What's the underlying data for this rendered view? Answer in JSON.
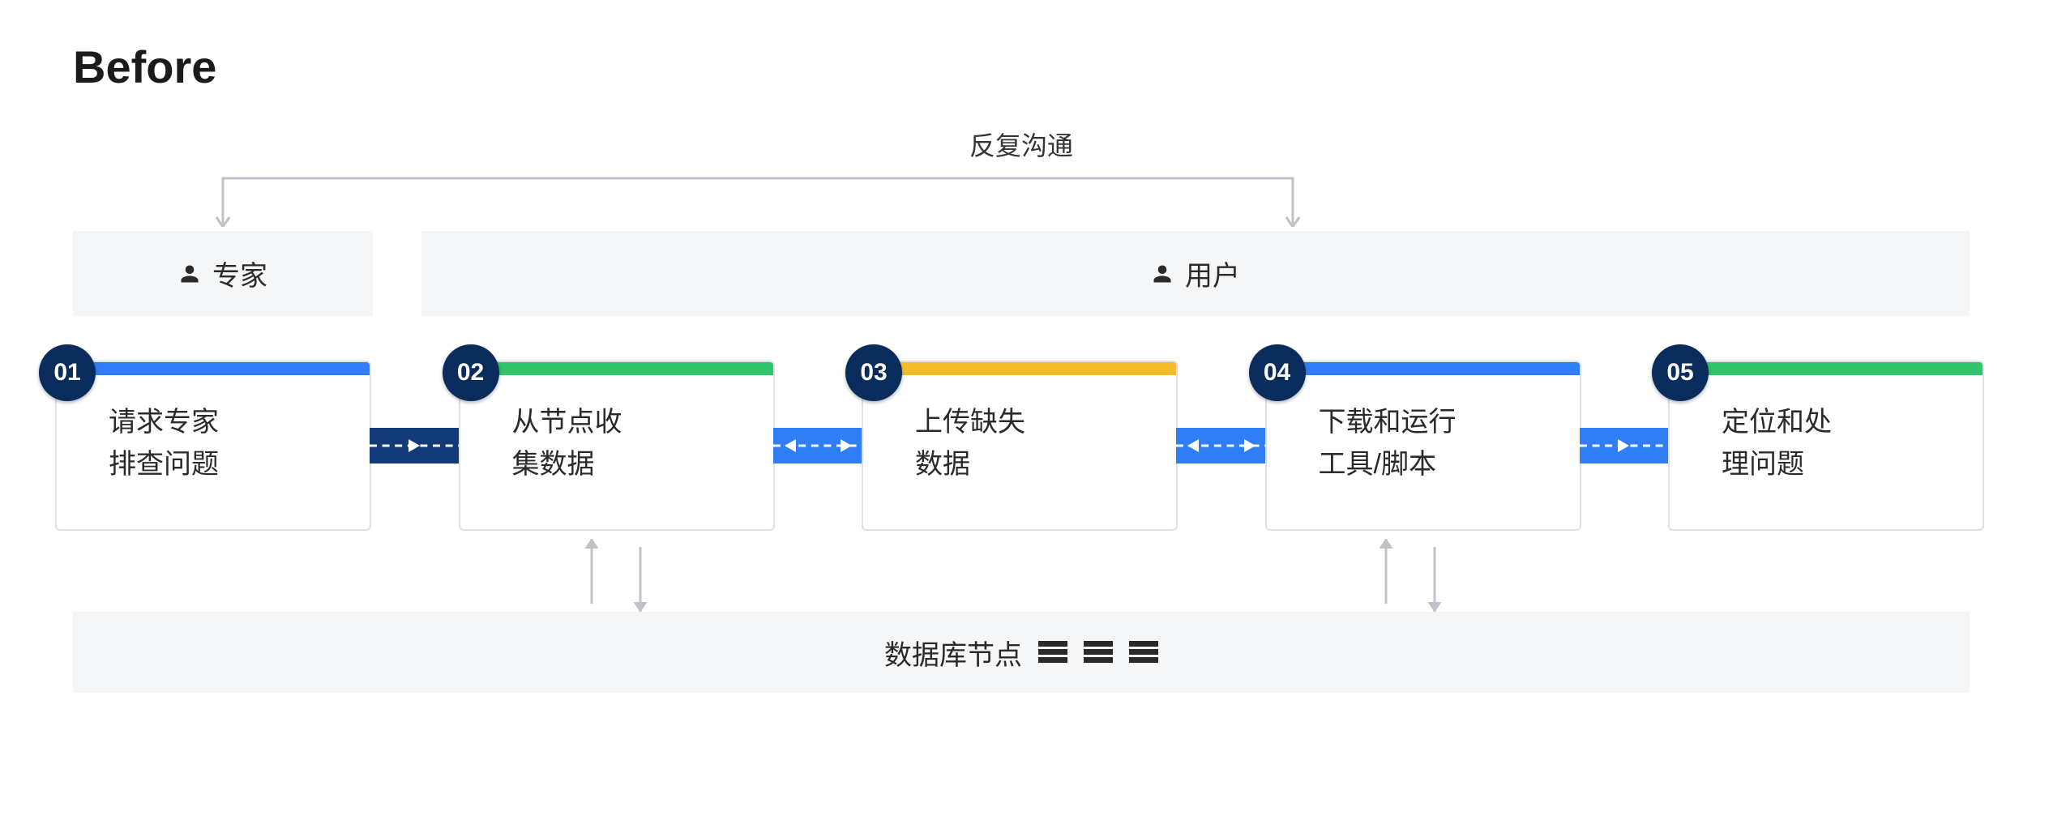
{
  "title": "Before",
  "comm_label": "反复沟通",
  "roles": {
    "expert": "专家",
    "user": "用户"
  },
  "steps": [
    {
      "num": "01",
      "line1": "请求专家",
      "line2": "排查问题",
      "color": "blue"
    },
    {
      "num": "02",
      "line1": "从节点收",
      "line2": "集数据",
      "color": "green"
    },
    {
      "num": "03",
      "line1": "上传缺失",
      "line2": "数据",
      "color": "yellow"
    },
    {
      "num": "04",
      "line1": "下载和运行",
      "line2": "工具/脚本",
      "color": "blue"
    },
    {
      "num": "05",
      "line1": "定位和处",
      "line2": "理问题",
      "color": "green"
    }
  ],
  "db_label": "数据库节点"
}
